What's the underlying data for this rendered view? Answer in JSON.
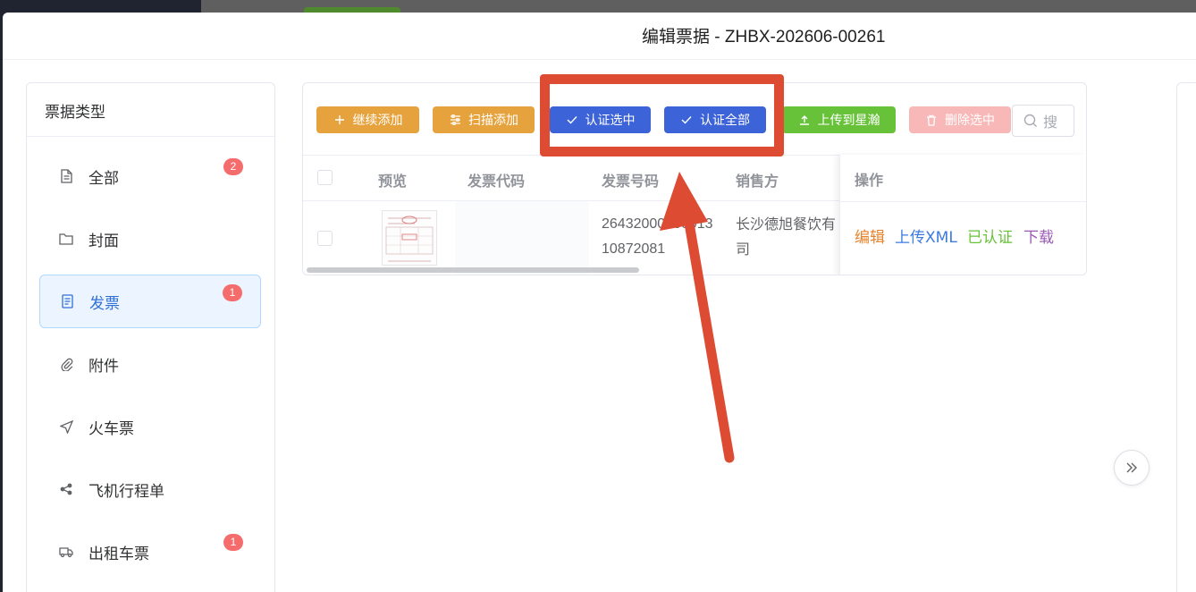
{
  "dialog": {
    "title": "编辑票据 - ZHBX-202606-00261"
  },
  "sidebar": {
    "header": "票据类型",
    "items": [
      {
        "label": "全部",
        "badge": "2"
      },
      {
        "label": "封面"
      },
      {
        "label": "发票",
        "badge": "1"
      },
      {
        "label": "附件"
      },
      {
        "label": "火车票"
      },
      {
        "label": "飞机行程单"
      },
      {
        "label": "出租车票",
        "badge": "1"
      }
    ]
  },
  "toolbar": {
    "continue_add": "继续添加",
    "scan_add": "扫描添加",
    "verify_selected": "认证选中",
    "verify_all": "认证全部",
    "upload_xinghan": "上传到星瀚",
    "delete_selected": "删除选中",
    "search_placeholder": "搜"
  },
  "table": {
    "headers": {
      "preview": "预览",
      "invoice_code": "发票代码",
      "invoice_number": "发票号码",
      "seller": "销售方",
      "actions": "操作"
    },
    "rows": [
      {
        "invoice_code": "",
        "invoice_number_line1": "26432000000013",
        "invoice_number_line2": "10872081",
        "seller_line1": "长沙德旭餐饮有",
        "seller_line2": "司",
        "actions": {
          "edit": "编辑",
          "upload_xml": "上传XML",
          "verified": "已认证",
          "download": "下载"
        }
      }
    ]
  },
  "colors": {
    "orange": "#e6a23c",
    "blue": "#3d63d8",
    "green": "#67c23a",
    "danger_light": "#f9b8b8",
    "badge": "#f56c6c",
    "annotation": "#dd4b32",
    "edit": "#e6822c",
    "upload_xml": "#3c7be0",
    "verified": "#67c23a",
    "download": "#9b59b6"
  }
}
